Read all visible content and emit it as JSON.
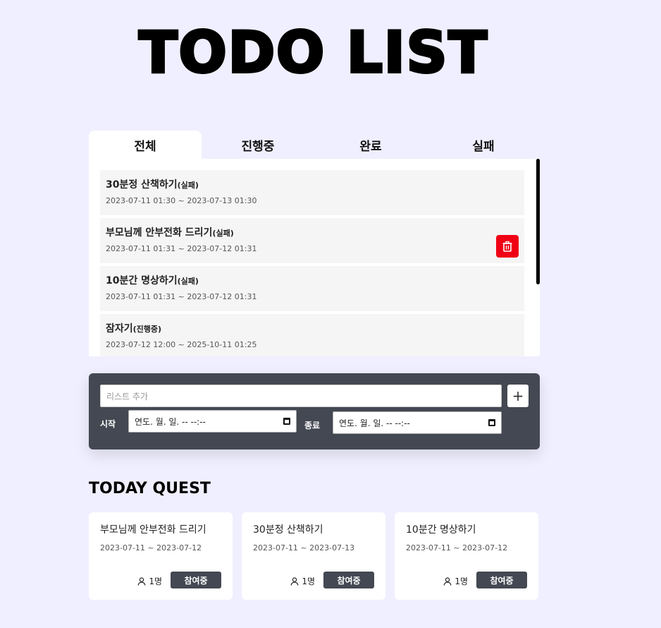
{
  "app": {
    "title": "TODO LIST"
  },
  "tabs": [
    {
      "label": "전체",
      "active": true
    },
    {
      "label": "진행중",
      "active": false
    },
    {
      "label": "완료",
      "active": false
    },
    {
      "label": "실패",
      "active": false
    }
  ],
  "todos": [
    {
      "title": "30분정 산책하기",
      "status": "(실패)",
      "date": "2023-07-11 01:30 ~ 2023-07-13 01:30"
    },
    {
      "title": "부모님께 안부전화 드리기",
      "status": "(실패)",
      "date": "2023-07-11 01:31 ~ 2023-07-12 01:31",
      "delete_icon": "trash-icon"
    },
    {
      "title": "10분간 명상하기",
      "status": "(실패)",
      "date": "2023-07-11 01:31 ~ 2023-07-12 01:31"
    },
    {
      "title": "잠자기",
      "status": "(진행중)",
      "date": "2023-07-12 12:00 ~ 2025-10-11 01:25"
    }
  ],
  "form": {
    "placeholder": "리스트 추가",
    "add_label": "+",
    "start_label": "시작",
    "end_label": "종료",
    "start_value": "연도. 월. 일. -- --:--",
    "end_value": "연도. 월. 일. -- --:--"
  },
  "quest": {
    "title": "TODAY QUEST",
    "cards": [
      {
        "title": "부모님께 안부전화 드리기",
        "date": "2023-07-11 ~ 2023-07-12",
        "people": "1명",
        "button": "참여중"
      },
      {
        "title": "30분정 산책하기",
        "date": "2023-07-11 ~ 2023-07-13",
        "people": "1명",
        "button": "참여중"
      },
      {
        "title": "10분간 명상하기",
        "date": "2023-07-11 ~ 2023-07-12",
        "people": "1명",
        "button": "참여중"
      }
    ]
  },
  "colors": {
    "background": "#f0efff",
    "dark": "#434852",
    "delete": "#f00015"
  }
}
